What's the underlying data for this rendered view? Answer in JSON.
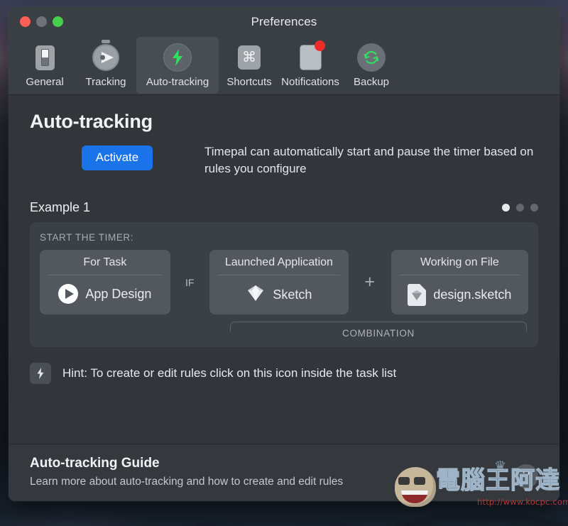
{
  "window": {
    "title": "Preferences",
    "traffic_lights": [
      "close",
      "minimize",
      "zoom"
    ]
  },
  "toolbar": {
    "tabs": [
      {
        "label": "General",
        "icon": "switch-icon",
        "selected": false,
        "badge": false
      },
      {
        "label": "Tracking",
        "icon": "stopwatch-icon",
        "selected": false,
        "badge": false
      },
      {
        "label": "Auto-tracking",
        "icon": "lightning-bolt-icon",
        "selected": true,
        "badge": false
      },
      {
        "label": "Shortcuts",
        "icon": "command-key-icon",
        "selected": false,
        "badge": false
      },
      {
        "label": "Notifications",
        "icon": "notification-card-icon",
        "selected": false,
        "badge": true
      },
      {
        "label": "Backup",
        "icon": "refresh-cycle-icon",
        "selected": false,
        "badge": false
      }
    ]
  },
  "main": {
    "page_title": "Auto-tracking",
    "activate_label": "Activate",
    "intro_text": "Timepal can automatically start and pause the timer based on rules you configure",
    "example_label": "Example 1",
    "page_dots": {
      "count": 3,
      "active_index": 0
    },
    "rule_panel": {
      "section_title": "START THE TIMER:",
      "cards": [
        {
          "header": "For Task",
          "value": "App Design",
          "icon": "play-circle-icon"
        },
        {
          "header": "Launched Application",
          "value": "Sketch",
          "icon": "sketch-diamond-icon"
        },
        {
          "header": "Working on File",
          "value": "design.sketch",
          "icon": "sketch-file-icon"
        }
      ],
      "separator_if": "IF",
      "separator_plus": "+",
      "combination_label": "COMBINATION"
    },
    "hint": {
      "icon": "lightning-bolt-icon",
      "text": "Hint: To create or edit rules click on this icon inside the task list"
    }
  },
  "footer": {
    "guide_title": "Auto-tracking Guide",
    "guide_subtitle": "Learn more about auto-tracking and how to create and edit rules",
    "help_label": "?"
  },
  "watermark": {
    "text": "電腦王阿達",
    "url": "http://www.kocpc.com.tw",
    "crown": "♛"
  },
  "colors": {
    "accent_blue": "#1a73e8",
    "accent_green": "#2ee05e",
    "badge_red": "#ef2c28",
    "window_bg": "#32363b",
    "toolbar_bg": "#3a3f44",
    "panel_bg": "#3b4046",
    "card_bg": "#53585e"
  }
}
